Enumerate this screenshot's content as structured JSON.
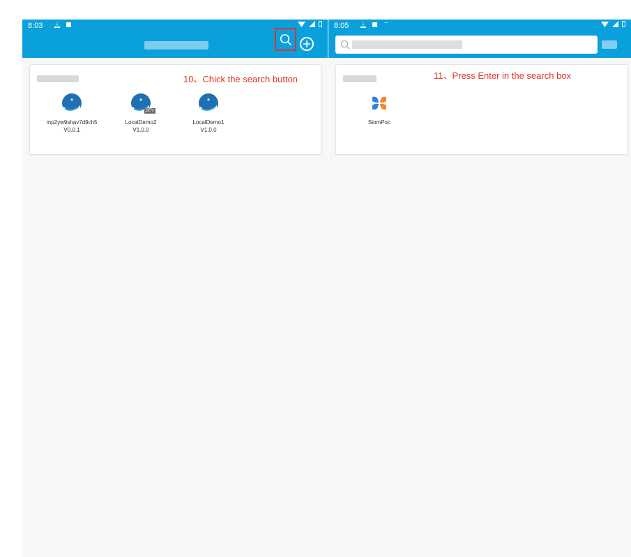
{
  "left": {
    "status": {
      "time": "8:03"
    },
    "annotation": "10、Chick the search button",
    "apps": [
      {
        "name": "mp2yw9shav7d9ch5",
        "version": "V0.0.1",
        "badge": ""
      },
      {
        "name": "LocalDemo2",
        "version": "V1.0.0",
        "badge": "DEV"
      },
      {
        "name": "LocalDemo1",
        "version": "V1.0.0",
        "badge": ""
      }
    ]
  },
  "right": {
    "status": {
      "time": "8:05"
    },
    "annotation": "11、Press Enter in the search box",
    "apps": [
      {
        "name": "SiomPoc",
        "version": ""
      }
    ]
  },
  "icons": {
    "search": "search-icon",
    "add": "add-circle-icon",
    "download": "download-icon",
    "wifi": "wifi-icon",
    "signal": "signal-icon",
    "battery": "battery-icon"
  },
  "colors": {
    "header": "#0aa0dc",
    "annotation": "#e03424",
    "highlight_box": "#e0312f",
    "background": "#f7f7f7"
  }
}
